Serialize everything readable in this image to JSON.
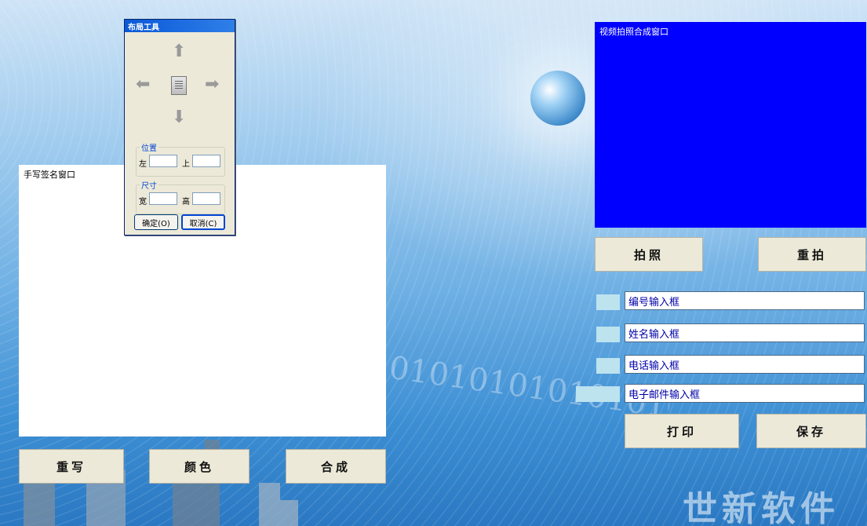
{
  "signature_panel": {
    "label": "手写签名窗口"
  },
  "video_panel": {
    "label": "视频拍照合成窗口"
  },
  "buttons": {
    "rewrite": "重写",
    "color": "颜色",
    "compose": "合成",
    "take_photo": "拍照",
    "retake": "重拍",
    "print": "打印",
    "save": "保存"
  },
  "fields": {
    "id_input": "编号输入框",
    "name_input": "姓名输入框",
    "phone_input": "电话输入框",
    "email_input": "电子邮件输入框"
  },
  "layout_dialog": {
    "title": "布局工具",
    "position_group": "位置",
    "left_label": "左",
    "top_label": "上",
    "size_group": "尺寸",
    "width_label": "宽",
    "height_label": "高",
    "ok_label": "确定(O)",
    "cancel_label": "取消(C)",
    "icons": {
      "up": "arrow-up-icon",
      "down": "arrow-down-icon",
      "left": "arrow-left-icon",
      "right": "arrow-right-icon",
      "center": "document-icon"
    }
  },
  "brand": "世新软件",
  "theme": {
    "video_bg": "#0000ff",
    "button_bg": "#ece9d8",
    "input_text": "#0000aa",
    "dialog_title_bg": "#0a58d8"
  }
}
